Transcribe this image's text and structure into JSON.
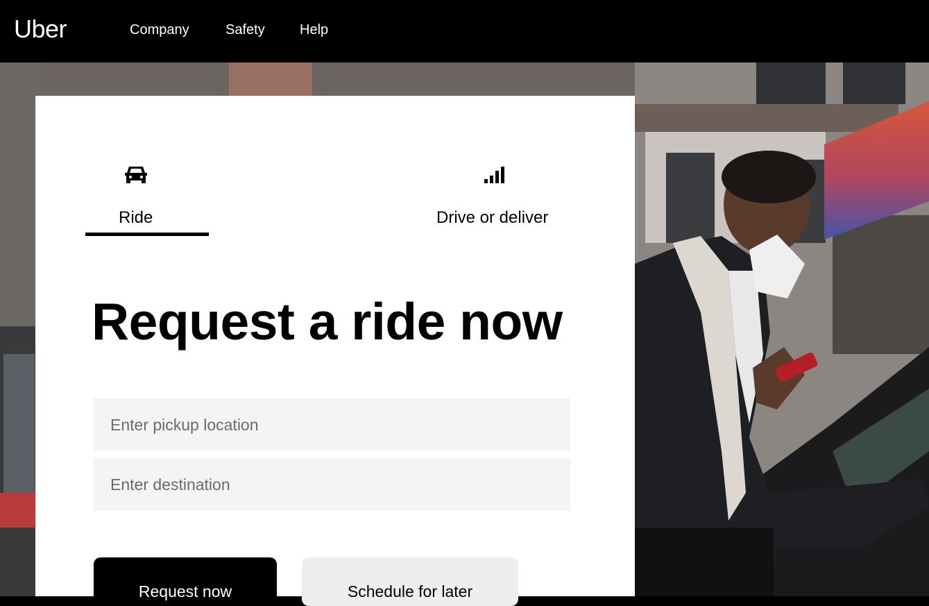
{
  "header": {
    "logo": "Uber",
    "nav": [
      {
        "label": "Company"
      },
      {
        "label": "Safety"
      },
      {
        "label": "Help"
      }
    ]
  },
  "tabs": [
    {
      "label": "Ride",
      "icon": "car-icon",
      "active": true
    },
    {
      "label": "Drive or deliver",
      "icon": "signal-bars-icon",
      "active": false
    }
  ],
  "main": {
    "headline": "Request a ride now",
    "pickup_placeholder": "Enter pickup location",
    "destination_placeholder": "Enter destination",
    "request_label": "Request now",
    "schedule_label": "Schedule for later"
  },
  "colors": {
    "header_bg": "#000000",
    "card_bg": "#ffffff",
    "input_bg": "#f4f4f4",
    "primary_button": "#000000",
    "secondary_button": "#eeeeee"
  }
}
